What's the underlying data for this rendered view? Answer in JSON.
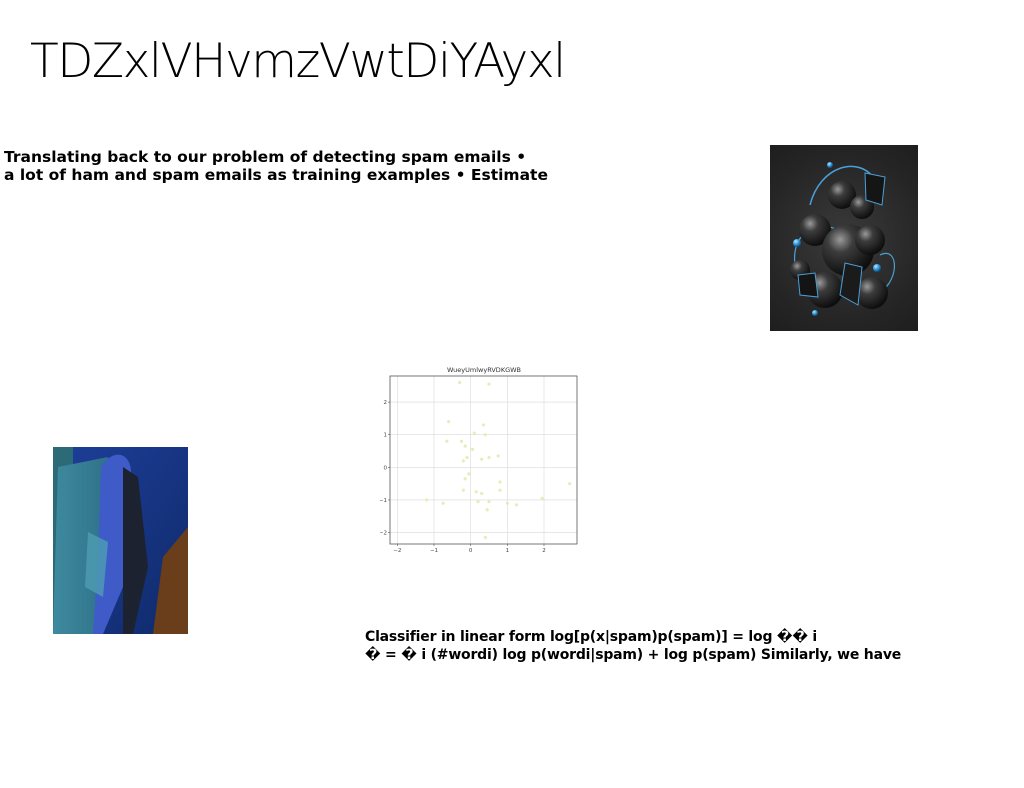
{
  "title": "TDZxlVHvmzVwtDiYAyxl",
  "text_block_1": {
    "line1": "Translating back to our problem of detecting spam emails •",
    "line2": "a lot of ham and spam emails as training examples • Estimate"
  },
  "text_block_2": {
    "line1": "Classifier in linear form log[p(x|spam)p(spam)] = log �� i",
    "line2": "� = � i (#wordi) log p(wordi|spam) + log p(spam) Similarly, we have"
  },
  "chart_data": {
    "type": "scatter",
    "title": "WueyUmlwyRVDKGWB",
    "xlim": [
      -2.2,
      2.9
    ],
    "ylim": [
      -2.35,
      2.8
    ],
    "xticks": [
      -2,
      -1,
      0,
      1,
      2
    ],
    "yticks": [
      -2,
      -1,
      0,
      1,
      2
    ],
    "grid": true,
    "point_color": "#e6edb8",
    "points": [
      [
        -0.3,
        2.6
      ],
      [
        0.5,
        2.55
      ],
      [
        -0.6,
        1.4
      ],
      [
        0.35,
        1.3
      ],
      [
        -0.65,
        0.8
      ],
      [
        0.1,
        1.05
      ],
      [
        0.4,
        1.0
      ],
      [
        -0.25,
        0.8
      ],
      [
        -0.15,
        0.65
      ],
      [
        0.05,
        0.55
      ],
      [
        -0.1,
        0.3
      ],
      [
        0.3,
        0.25
      ],
      [
        0.5,
        0.3
      ],
      [
        0.75,
        0.35
      ],
      [
        -0.2,
        0.2
      ],
      [
        -0.05,
        -0.2
      ],
      [
        -0.15,
        -0.35
      ],
      [
        0.8,
        -0.45
      ],
      [
        -0.2,
        -0.7
      ],
      [
        0.15,
        -0.75
      ],
      [
        0.3,
        -0.8
      ],
      [
        0.8,
        -0.7
      ],
      [
        -1.2,
        -1.0
      ],
      [
        -0.75,
        -1.1
      ],
      [
        0.2,
        -1.05
      ],
      [
        0.5,
        -1.05
      ],
      [
        1.0,
        -1.1
      ],
      [
        1.25,
        -1.15
      ],
      [
        1.95,
        -0.95
      ],
      [
        2.7,
        -0.5
      ],
      [
        0.45,
        -1.3
      ],
      [
        0.4,
        -2.15
      ]
    ]
  }
}
